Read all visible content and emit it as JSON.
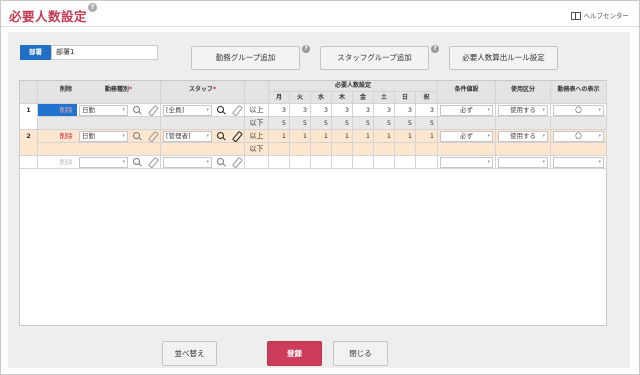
{
  "header": {
    "title": "必要人数設定",
    "help_mark": "?",
    "help_center": "ヘルプセンター"
  },
  "department": {
    "label": "部署",
    "value": "部署1"
  },
  "toolbar": {
    "work_group_add": "勤務グループ追加",
    "staff_group_add": "スタッフグループ追加",
    "rule_settings": "必要人数算出ルール設定",
    "help_mark": "?"
  },
  "table": {
    "headers": {
      "delete": "削除",
      "work_type": "勤務種別",
      "staff": "スタッフ",
      "required": "必要人数設定",
      "days": [
        "月",
        "火",
        "水",
        "木",
        "金",
        "土",
        "日",
        "祝"
      ],
      "condition": "条件値設",
      "usage": "使用区分",
      "display": "勤務表への表示",
      "required_mark": "*"
    },
    "rows": [
      {
        "no": "1",
        "delete": "削除",
        "work_type": "日勤",
        "staff": "[全員]",
        "min_label": "以上",
        "min_values": [
          "3",
          "3",
          "3",
          "3",
          "3",
          "3",
          "3",
          "3"
        ],
        "max_label": "以下",
        "max_values": [
          "5",
          "5",
          "5",
          "5",
          "5",
          "5",
          "5",
          "5"
        ],
        "condition": "必ず",
        "usage": "使用する",
        "display": "〇"
      },
      {
        "no": "2",
        "delete": "削除",
        "work_type": "日勤",
        "staff": "[管理者]",
        "min_label": "以上",
        "min_values": [
          "1",
          "1",
          "1",
          "1",
          "1",
          "1",
          "1",
          "1"
        ],
        "max_label": "以下",
        "max_values": [
          "",
          "",
          "",
          "",
          "",
          "",
          "",
          ""
        ],
        "condition": "必ず",
        "usage": "使用する",
        "display": "〇"
      },
      {
        "no": "",
        "delete": "削除"
      }
    ]
  },
  "footer": {
    "sort": "並べ替え",
    "register": "登録",
    "close": "閉じる"
  },
  "colors": {
    "accent": "#c43a52",
    "blue": "#1f6fc4",
    "row_highlight": "#fde6cf",
    "register_button": "#cc3d5c"
  }
}
